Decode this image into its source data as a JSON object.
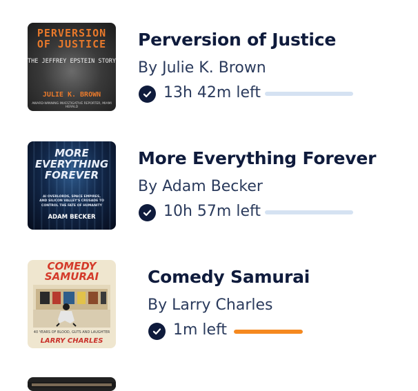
{
  "books": [
    {
      "title": "Perversion of Justice",
      "author": "By Julie K. Brown",
      "time_left": "13h 42m left",
      "progress": 0.0,
      "progress_color": "#d5e2f2",
      "cover": {
        "line1": "PERVERSION",
        "line2": "OF JUSTICE",
        "subtitle": "THE JEFFREY EPSTEIN STORY",
        "author": "JULIE K. BROWN",
        "tagline": "AWARD-WINNING INVESTIGATIVE REPORTER, MIAMI HERALD"
      }
    },
    {
      "title": "More Everything Forever",
      "author": "By Adam Becker",
      "time_left": "10h 57m left",
      "progress": 0.0,
      "progress_color": "#d5e2f2",
      "cover": {
        "line1": "MORE",
        "line2": "EVERYTHING",
        "line3": "FOREVER",
        "tag1": "AI OVERLORDS, SPACE EMPIRES,",
        "tag2": "AND SILICON VALLEY'S CRUSADE TO",
        "tag3": "CONTROL THE FATE OF HUMANITY",
        "author": "ADAM BECKER"
      }
    },
    {
      "title": "Comedy Samurai",
      "author": "By Larry Charles",
      "time_left": "1m left",
      "progress": 1.0,
      "progress_color": "#f5891f",
      "cover": {
        "line1": "COMEDY",
        "line2": "SAMURAI",
        "tagline": "40 YEARS OF BLOOD, GUTS AND LAUGHTER",
        "author": "LARRY CHARLES"
      }
    }
  ]
}
